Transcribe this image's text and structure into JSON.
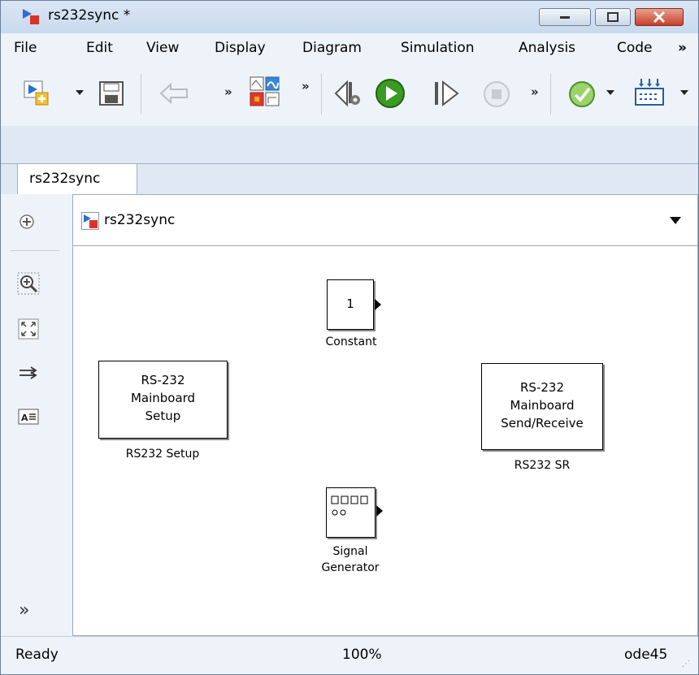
{
  "window": {
    "title": "rs232sync *"
  },
  "menu": {
    "items": [
      "File",
      "Edit",
      "View",
      "Display",
      "Diagram",
      "Simulation",
      "Analysis",
      "Code"
    ],
    "overflow": "»"
  },
  "toolbar": {
    "icons": [
      "new-model-icon",
      "dropdown-arrow-icon",
      "save-icon",
      "back-arrow-icon",
      "overflow-chevron-icon",
      "library-browser-icon",
      "overflow-chevron-icon",
      "step-back-icon",
      "run-icon",
      "step-forward-icon",
      "stop-icon",
      "overflow-chevron-icon",
      "check-icon",
      "dropdown-arrow-icon",
      "sample-time-icon",
      "dropdown-arrow-icon"
    ]
  },
  "tabs": [
    {
      "label": "rs232sync"
    }
  ],
  "address": {
    "path": "rs232sync"
  },
  "blocks": {
    "constant": {
      "value": "1",
      "label": "Constant"
    },
    "rs232_setup": {
      "lines": [
        "RS-232",
        "Mainboard",
        "Setup"
      ],
      "label": "RS232 Setup"
    },
    "rs232_sr": {
      "lines": [
        "RS-232",
        "Mainboard",
        "Send/Receive"
      ],
      "label": "RS232 SR"
    },
    "signal_generator": {
      "label_line1": "Signal",
      "label_line2": "Generator"
    }
  },
  "status": {
    "left": "Ready",
    "zoom": "100%",
    "solver": "ode45"
  },
  "colors": {
    "accent": "#2f7d1c",
    "close_button": "#c7402a",
    "chrome": "#dfe8f3"
  }
}
